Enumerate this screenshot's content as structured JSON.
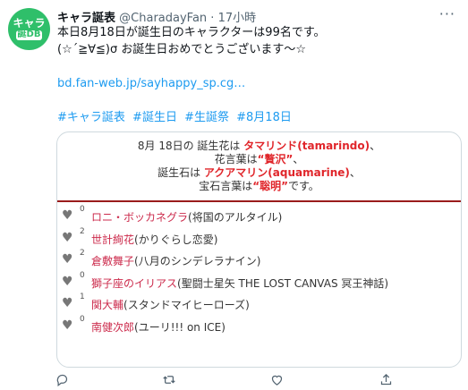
{
  "author": {
    "avatar_line1": "キャラ",
    "avatar_line2": "誕DB",
    "name": "キャラ誕表",
    "handle": "@CharadayFan",
    "separator": "·",
    "time": "17小時"
  },
  "tweet": {
    "line1": "本日8月18日が誕生日のキャラクターは99名です。",
    "line2": "(☆´≧∀≦)σ お誕生日おめでとうございます〜☆",
    "link": "bd.fan-web.jp/sayhappy_sp.cg…",
    "hashtags": [
      "#キャラ誕表",
      "#誕生日",
      "#生誕祭",
      "#8月18日"
    ]
  },
  "card": {
    "h1_pre": "8月 18日の 誕生花は ",
    "h1_flower": "タマリンド(tamarindo)",
    "h1_post": "、",
    "h2_pre": "花言葉は",
    "h2_word": "“贅沢”",
    "h2_post": "、",
    "h3_pre": "誕生石は ",
    "h3_stone": "アクアマリン(aquamarine)",
    "h3_post": "、",
    "h4_pre": "宝石言葉は",
    "h4_word": "“聡明”",
    "h4_post": "です。",
    "entries": [
      {
        "count": "0",
        "name": "ロニ・ボッカネグラ",
        "source": "(将国のアルタイル)"
      },
      {
        "count": "2",
        "name": "世計絢花",
        "source": "(かりぐらし恋愛)"
      },
      {
        "count": "2",
        "name": "倉敷舞子",
        "source": "(八月のシンデレラナイン)"
      },
      {
        "count": "0",
        "name": "獅子座のイリアス",
        "source": "(聖闘士星矢 THE LOST CANVAS 冥王神話)"
      },
      {
        "count": "1",
        "name": "関大輔",
        "source": "(スタンドマイヒーローズ)"
      },
      {
        "count": "0",
        "name": "南健次郎",
        "source": "(ユーリ!!! on ICE)"
      }
    ]
  },
  "icons": {
    "more": "more-icon",
    "heart": "heart-icon",
    "reply": "reply-icon",
    "retweet": "retweet-icon",
    "like": "like-icon",
    "share": "share-icon"
  },
  "colors": {
    "avatar": "#2fbf6a",
    "link": "#1d9bf0",
    "highlight": "#e0252a",
    "character_name": "#cc2b4c",
    "card_divider": "#9a1c1c"
  }
}
